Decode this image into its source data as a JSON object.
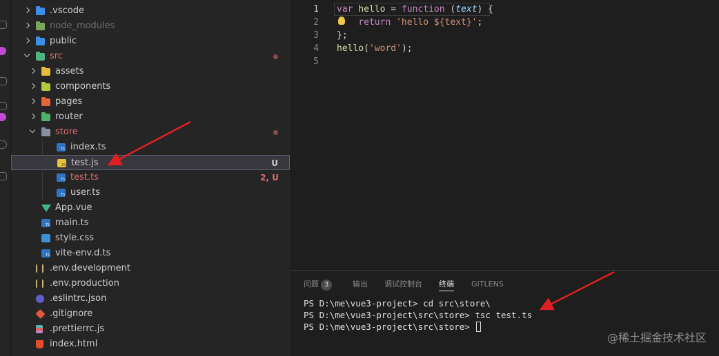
{
  "explorer": {
    "items": [
      {
        "label": ".vscode",
        "icon": "vscode-folder-icon",
        "depth": 0,
        "kind": "folder",
        "open": false,
        "style": "normal"
      },
      {
        "label": "node_modules",
        "icon": "node-folder-icon",
        "depth": 0,
        "kind": "folder",
        "open": false,
        "style": "dim"
      },
      {
        "label": "public",
        "icon": "public-folder-icon",
        "depth": 0,
        "kind": "folder",
        "open": false,
        "style": "normal"
      },
      {
        "label": "src",
        "icon": "src-folder-icon",
        "depth": 0,
        "kind": "folder",
        "open": true,
        "style": "red"
      },
      {
        "label": "assets",
        "icon": "assets-folder-icon",
        "depth": 1,
        "kind": "folder",
        "open": false,
        "style": "normal"
      },
      {
        "label": "components",
        "icon": "components-folder-icon",
        "depth": 1,
        "kind": "folder",
        "open": false,
        "style": "normal"
      },
      {
        "label": "pages",
        "icon": "pages-folder-icon",
        "depth": 1,
        "kind": "folder",
        "open": false,
        "style": "normal"
      },
      {
        "label": "router",
        "icon": "router-folder-icon",
        "depth": 1,
        "kind": "folder",
        "open": false,
        "style": "normal"
      },
      {
        "label": "store",
        "icon": "store-folder-icon",
        "depth": 1,
        "kind": "folder",
        "open": true,
        "style": "red"
      },
      {
        "label": "index.ts",
        "icon": "typescript-file-icon",
        "depth": 2,
        "kind": "ts",
        "style": "normal"
      },
      {
        "label": "test.js",
        "icon": "javascript-file-icon",
        "depth": 2,
        "kind": "js",
        "style": "normal",
        "status": "U",
        "selected": true
      },
      {
        "label": "test.ts",
        "icon": "typescript-file-icon",
        "depth": 2,
        "kind": "ts",
        "style": "red",
        "status": "2, U"
      },
      {
        "label": "user.ts",
        "icon": "typescript-file-icon",
        "depth": 2,
        "kind": "ts",
        "style": "normal"
      },
      {
        "label": "App.vue",
        "icon": "vue-file-icon",
        "depth": 1,
        "kind": "vue",
        "style": "normal"
      },
      {
        "label": "main.ts",
        "icon": "typescript-file-icon",
        "depth": 1,
        "kind": "ts",
        "style": "normal"
      },
      {
        "label": "style.css",
        "icon": "css-file-icon",
        "depth": 1,
        "kind": "css",
        "style": "normal"
      },
      {
        "label": "vite-env.d.ts",
        "icon": "typescript-def-file-icon",
        "depth": 1,
        "kind": "tsdef",
        "style": "normal"
      },
      {
        "label": ".env.development",
        "icon": "env-file-icon",
        "depth": 0,
        "kind": "env",
        "style": "normal"
      },
      {
        "label": ".env.production",
        "icon": "env-file-icon",
        "depth": 0,
        "kind": "env",
        "style": "normal"
      },
      {
        "label": ".eslintrc.json",
        "icon": "eslint-file-icon",
        "depth": 0,
        "kind": "eslint",
        "style": "normal"
      },
      {
        "label": ".gitignore",
        "icon": "git-file-icon",
        "depth": 0,
        "kind": "git",
        "style": "normal"
      },
      {
        "label": ".prettierrc.js",
        "icon": "prettier-file-icon",
        "depth": 0,
        "kind": "prettier",
        "style": "normal"
      },
      {
        "label": "index.html",
        "icon": "html-file-icon",
        "depth": 0,
        "kind": "html",
        "style": "normal"
      }
    ]
  },
  "editor": {
    "line_numbers": [
      "1",
      "2",
      "3",
      "4",
      "5"
    ],
    "lines": [
      [
        {
          "t": "var",
          "c": "kw"
        },
        {
          "t": " ",
          "c": ""
        },
        {
          "t": "hello",
          "c": "fn"
        },
        {
          "t": " = ",
          "c": ""
        },
        {
          "t": "function",
          "c": "kw"
        },
        {
          "t": " (",
          "c": ""
        },
        {
          "t": "text",
          "c": "pm"
        },
        {
          "t": ") {",
          "c": ""
        }
      ],
      [
        {
          "t": "    ",
          "c": ""
        },
        {
          "t": "return",
          "c": "kw2"
        },
        {
          "t": " ",
          "c": ""
        },
        {
          "t": "'hello ${text}'",
          "c": "st"
        },
        {
          "t": ";",
          "c": ""
        }
      ],
      [
        {
          "t": "};",
          "c": ""
        }
      ],
      [
        {
          "t": "hello",
          "c": "fn"
        },
        {
          "t": "(",
          "c": ""
        },
        {
          "t": "'word'",
          "c": "st"
        },
        {
          "t": ");",
          "c": ""
        }
      ],
      []
    ]
  },
  "panel": {
    "tabs": [
      {
        "label": "问题",
        "count": "3",
        "active": false
      },
      {
        "label": "输出",
        "active": false
      },
      {
        "label": "调试控制台",
        "active": false
      },
      {
        "label": "终端",
        "active": true
      },
      {
        "label": "GITLENS",
        "active": false
      }
    ],
    "terminal_lines": [
      "PS D:\\me\\vue3-project> cd src\\store\\",
      "PS D:\\me\\vue3-project\\src\\store> tsc test.ts",
      "PS D:\\me\\vue3-project\\src\\store> "
    ]
  },
  "watermark": "@稀土掘金技术社区",
  "colors": {
    "annotation_arrow": "#e02020",
    "modified_red": "#e06c6c",
    "selection_border": "#5a5f73"
  }
}
